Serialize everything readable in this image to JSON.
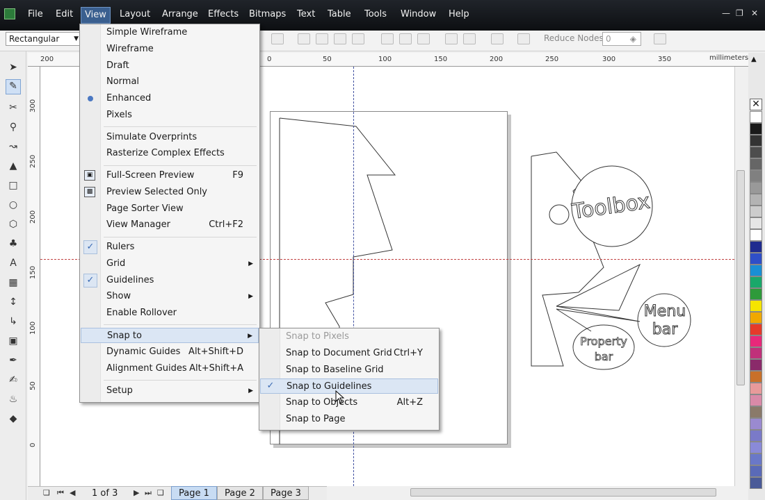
{
  "menubar": {
    "items": [
      "File",
      "Edit",
      "View",
      "Layout",
      "Arrange",
      "Effects",
      "Bitmaps",
      "Text",
      "Table",
      "Tools",
      "Window",
      "Help"
    ],
    "active": "View",
    "window_controls": [
      "minimize-icon",
      "restore-icon",
      "close-icon"
    ]
  },
  "propbar": {
    "shape": "Rectangular",
    "reduce_nodes_label": "Reduce Nodes",
    "reduce_nodes_value": "0"
  },
  "ruler": {
    "unit": "millimeters",
    "h_ticks": [
      "200",
      "0",
      "50",
      "100",
      "150",
      "200",
      "250",
      "300",
      "350"
    ],
    "v_ticks": [
      "300",
      "250",
      "200",
      "150",
      "100",
      "50",
      "0"
    ]
  },
  "view_menu": {
    "items": [
      {
        "label": "Simple Wireframe"
      },
      {
        "label": "Wireframe"
      },
      {
        "label": "Draft"
      },
      {
        "label": "Normal"
      },
      {
        "label": "Enhanced",
        "radio": true
      },
      {
        "label": "Pixels"
      },
      {
        "label": "Simulate Overprints"
      },
      {
        "label": "Rasterize Complex Effects"
      },
      {
        "label": "Full-Screen Preview",
        "shortcut": "F9",
        "icon": "fullscreen-preview-icon"
      },
      {
        "label": "Preview Selected Only",
        "icon": "preview-selected-icon"
      },
      {
        "label": "Page Sorter View"
      },
      {
        "label": "View Manager",
        "shortcut": "Ctrl+F2"
      },
      {
        "label": "Rulers",
        "checked": true
      },
      {
        "label": "Grid",
        "submenu": true
      },
      {
        "label": "Guidelines",
        "checked": true
      },
      {
        "label": "Show",
        "submenu": true
      },
      {
        "label": "Enable Rollover"
      },
      {
        "label": "Snap to",
        "submenu": true,
        "highlighted": true
      },
      {
        "label": "Dynamic Guides",
        "shortcut": "Alt+Shift+D"
      },
      {
        "label": "Alignment Guides",
        "shortcut": "Alt+Shift+A"
      },
      {
        "label": "Setup",
        "submenu": true
      }
    ]
  },
  "snap_menu": {
    "items": [
      {
        "label": "Snap to Pixels",
        "disabled": true
      },
      {
        "label": "Snap to Document Grid",
        "shortcut": "Ctrl+Y"
      },
      {
        "label": "Snap to Baseline Grid"
      },
      {
        "label": "Snap to Guidelines",
        "checked": true,
        "highlighted": true
      },
      {
        "label": "Snap to Objects",
        "shortcut": "Alt+Z"
      },
      {
        "label": "Snap to Page"
      }
    ]
  },
  "artwork": {
    "bubble_toolbox": "Toolbox",
    "bubble_menu_1": "Menu",
    "bubble_menu_2": "bar",
    "bubble_prop_1": "Property",
    "bubble_prop_2": "bar"
  },
  "pages": {
    "count_text": "1 of 3",
    "tabs": [
      "Page 1",
      "Page 2",
      "Page 3"
    ],
    "active": "Page 1"
  },
  "palette_colors": [
    "#ffffff",
    "#1a1a1a",
    "#333333",
    "#4d4d4d",
    "#666666",
    "#808080",
    "#999999",
    "#b3b3b3",
    "#cccccc",
    "#e6e6e6",
    "#ffffff",
    "#1f2b8f",
    "#2f4fc8",
    "#1a8fd4",
    "#1aa86a",
    "#2e9a3a",
    "#f5e500",
    "#f0a800",
    "#e63a2a",
    "#e8287a",
    "#c0307a",
    "#8a2a6a",
    "#c8702a",
    "#e89a9a",
    "#d98aa8",
    "#8a7a6a",
    "#9a8ad0",
    "#7a7ac8",
    "#8a8ad8",
    "#6a78c8",
    "#5a6ab8",
    "#4a5a98"
  ]
}
